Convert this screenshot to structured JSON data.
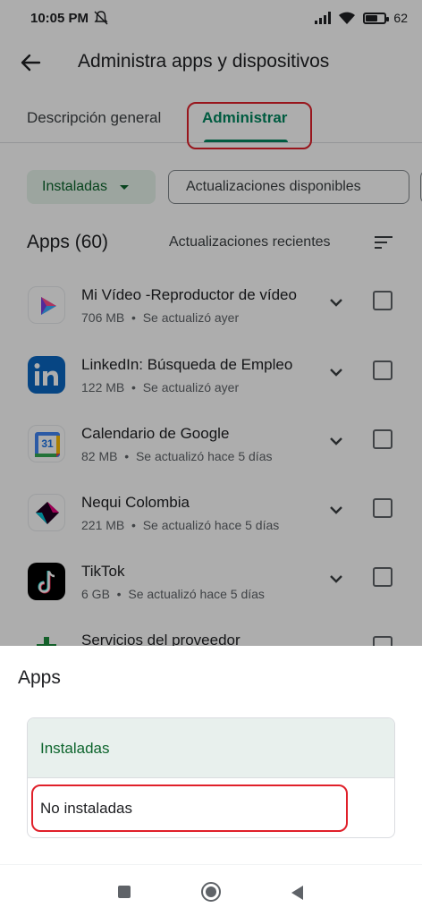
{
  "status_bar": {
    "time": "10:05 PM",
    "battery": "62",
    "battery_level": 0.62
  },
  "app_bar": {
    "title": "Administra apps y dispositivos"
  },
  "tabs": [
    {
      "label": "Descripción general"
    },
    {
      "label": "Administrar"
    }
  ],
  "filters": {
    "installed_chip": "Instaladas",
    "updates_chip": "Actualizaciones disponibles"
  },
  "apps_header": {
    "count_label": "Apps (60)",
    "sort_label": "Actualizaciones recientes"
  },
  "apps": [
    {
      "name": "Mi Vídeo -Reproductor de vídeo",
      "size": "706 MB",
      "updated": "Se actualizó ayer",
      "icon": "mi-video-icon"
    },
    {
      "name": "LinkedIn: Búsqueda de Empleo",
      "size": "122 MB",
      "updated": "Se actualizó ayer",
      "icon": "linkedin-icon"
    },
    {
      "name": "Calendario de Google",
      "size": "82 MB",
      "updated": "Se actualizó hace 5 días",
      "icon": "google-calendar-icon",
      "icon_text": "31"
    },
    {
      "name": "Nequi Colombia",
      "size": "221 MB",
      "updated": "Se actualizó hace 5 días",
      "icon": "nequi-icon"
    },
    {
      "name": "TikTok",
      "size": "6 GB",
      "updated": "Se actualizó hace 5 días",
      "icon": "tiktok-icon"
    },
    {
      "name": "Servicios del proveedor",
      "size": "",
      "updated": "",
      "icon": "carrier-services-icon"
    }
  ],
  "sheet": {
    "title": "Apps",
    "options": [
      {
        "label": "Instaladas",
        "selected": true
      },
      {
        "label": "No instaladas",
        "selected": false
      }
    ]
  },
  "colors": {
    "accent": "#01875f",
    "highlight": "#e0202a",
    "selected_bg": "#e8f0ed"
  }
}
